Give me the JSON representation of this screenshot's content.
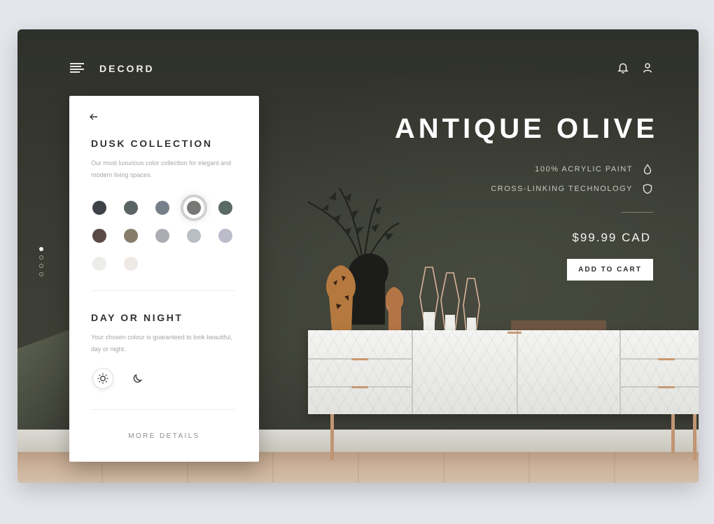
{
  "header": {
    "brand": "DECORD",
    "menu_icon": "menu-icon",
    "notification_icon": "bell-icon",
    "account_icon": "user-icon"
  },
  "pagination": {
    "total": 4,
    "active_index": 0
  },
  "panel": {
    "back_icon": "arrow-left-icon",
    "collection_title": "DUSK COLLECTION",
    "collection_desc": "Our most luxurious color collection for elegant and modern living spaces.",
    "swatches": [
      {
        "color": "#3d4249",
        "selected": false
      },
      {
        "color": "#5a6463",
        "selected": false
      },
      {
        "color": "#76808a",
        "selected": false
      },
      {
        "color": "#767875",
        "selected": true
      },
      {
        "color": "#5a6a65",
        "selected": false
      },
      {
        "color": "#5a4a46",
        "selected": false
      },
      {
        "color": "#857d6a",
        "selected": false
      },
      {
        "color": "#acadb2",
        "selected": false
      },
      {
        "color": "#b9bec4",
        "selected": false
      },
      {
        "color": "#bcbbc9",
        "selected": false
      },
      {
        "color": "#ececea",
        "selected": false
      },
      {
        "color": "#efe9e6",
        "selected": false
      }
    ],
    "daynight_title": "DAY OR NIGHT",
    "daynight_desc": "Your chosen colour is guaranteed to look beautiful, day or night.",
    "modes": [
      {
        "icon": "sun-icon",
        "active": true
      },
      {
        "icon": "moon-icon",
        "active": false
      }
    ],
    "more_details": "MORE DETAILS"
  },
  "product": {
    "title": "ANTIQUE OLIVE",
    "features": [
      {
        "label": "100% ACRYLIC PAINT",
        "icon": "droplet-icon"
      },
      {
        "label": "CROSS-LINKING TECHNOLOGY",
        "icon": "shield-icon"
      }
    ],
    "price": "$99.99 CAD",
    "add_to_cart": "ADD TO CART"
  },
  "colors": {
    "wall": "#3a3c34",
    "panel_bg": "#ffffff",
    "accent_text": "#ffffff"
  }
}
